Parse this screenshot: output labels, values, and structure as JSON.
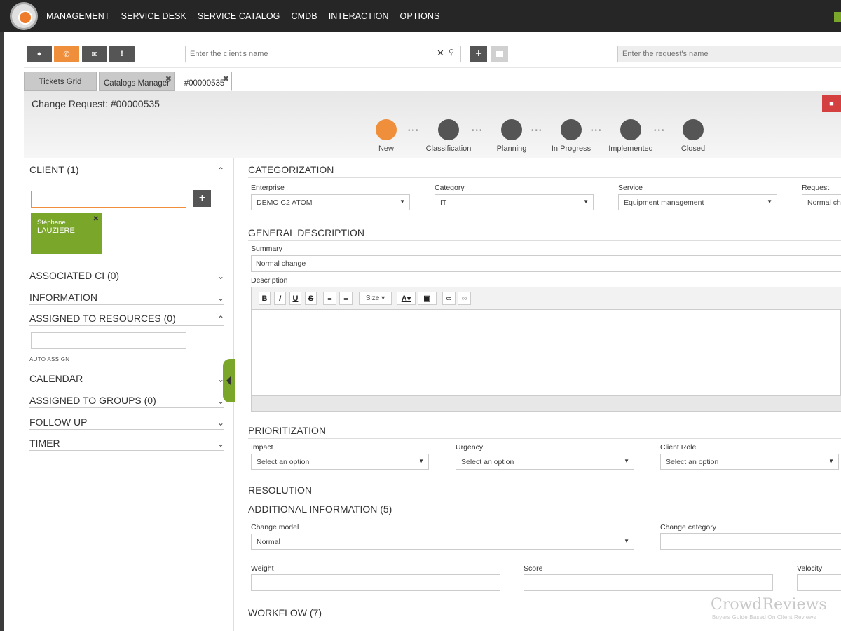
{
  "nav": [
    "MANAGEMENT",
    "SERVICE DESK",
    "SERVICE CATALOG",
    "CMDB",
    "INTERACTION",
    "OPTIONS"
  ],
  "toolbar": {
    "client_placeholder": "Enter the client's name",
    "request_placeholder": "Enter the request's name"
  },
  "tabs": [
    {
      "label": "Tickets Grid"
    },
    {
      "label": "Catalogs Manager"
    },
    {
      "label": "#00000535"
    }
  ],
  "page": {
    "title": "Change Request: #00000535"
  },
  "steps": [
    {
      "label": "New"
    },
    {
      "label": "Classification"
    },
    {
      "label": "Planning"
    },
    {
      "label": "In Progress"
    },
    {
      "label": "Implemented"
    },
    {
      "label": "Closed"
    }
  ],
  "left": {
    "client": "CLIENT (1)",
    "client_first": "Stéphane",
    "client_last": "LAUZIERE",
    "associated_ci": "ASSOCIATED CI (0)",
    "information": "INFORMATION",
    "assigned_resources": "ASSIGNED TO RESOURCES (0)",
    "auto_assign": "AUTO ASSIGN",
    "calendar": "CALENDAR",
    "assigned_groups": "ASSIGNED TO GROUPS (0)",
    "follow_up": "FOLLOW UP",
    "timer": "TIMER"
  },
  "categorization": {
    "title": "CATEGORIZATION",
    "enterprise_label": "Enterprise",
    "enterprise": "DEMO C2 ATOM",
    "category_label": "Category",
    "category": "IT",
    "service_label": "Service",
    "service": "Equipment management",
    "request_label": "Request",
    "request": "Normal ch"
  },
  "general": {
    "title": "GENERAL DESCRIPTION",
    "summary_label": "Summary",
    "summary": "Normal change",
    "description_label": "Description",
    "size_label": "Size"
  },
  "prioritization": {
    "title": "PRIORITIZATION",
    "impact_label": "Impact",
    "urgency_label": "Urgency",
    "role_label": "Client Role",
    "placeholder": "Select an option"
  },
  "resolution": {
    "title": "RESOLUTION"
  },
  "additional": {
    "title": "ADDITIONAL INFORMATION (5)",
    "change_model_label": "Change model",
    "change_model": "Normal",
    "change_category_label": "Change category",
    "weight_label": "Weight",
    "score_label": "Score",
    "velocity_label": "Velocity"
  },
  "workflow": {
    "title": "WORKFLOW (7)"
  },
  "watermark": {
    "title": "CrowdReviews",
    "subtitle": "Buyers Guide Based On Client Reviews"
  }
}
